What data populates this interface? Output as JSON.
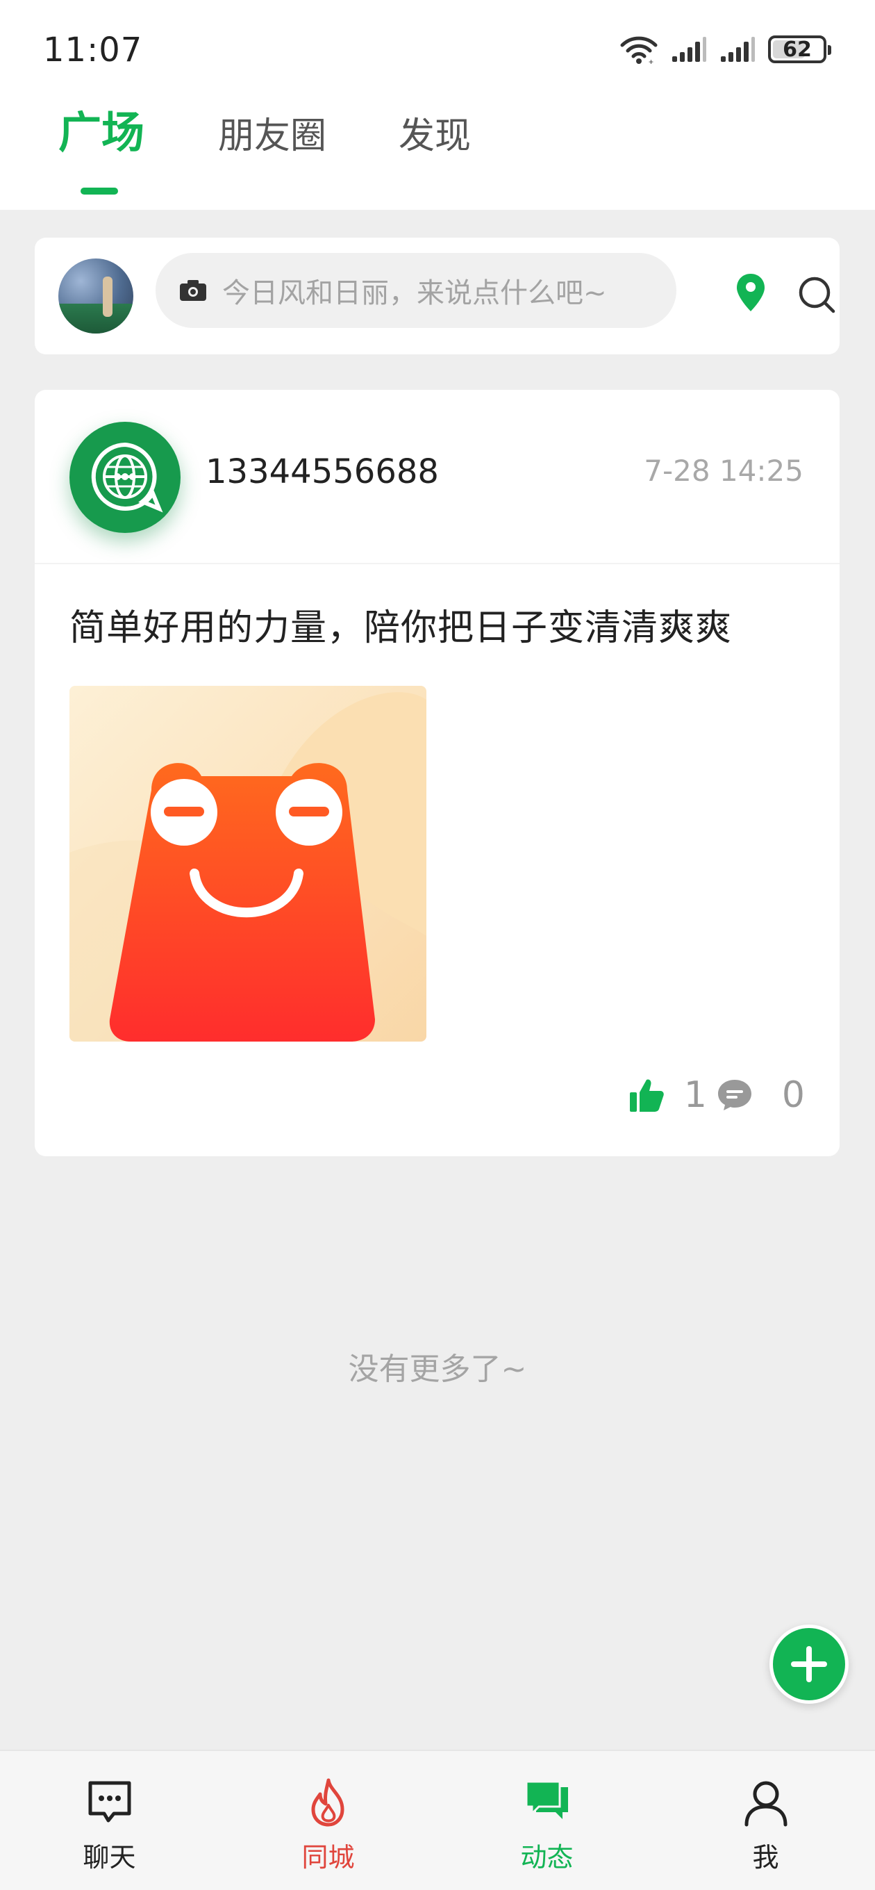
{
  "status_bar": {
    "time": "11:07",
    "battery": "62"
  },
  "top_tabs": [
    {
      "label": "广场",
      "active": true
    },
    {
      "label": "朋友圈",
      "active": false
    },
    {
      "label": "发现",
      "active": false
    }
  ],
  "composer": {
    "placeholder": "今日风和日丽，来说点什么吧~"
  },
  "post": {
    "username": "13344556688",
    "time": "7-28 14:25",
    "text": "简单好用的力量，陪你把日子变清清爽爽",
    "likes": "1",
    "comments": "0"
  },
  "feed": {
    "end_text": "没有更多了~"
  },
  "bottom_nav": [
    {
      "label": "聊天",
      "icon": "chat-bubble-icon"
    },
    {
      "label": "同城",
      "icon": "flame-icon"
    },
    {
      "label": "动态",
      "icon": "moments-icon",
      "active": true
    },
    {
      "label": "我",
      "icon": "person-icon"
    }
  ],
  "colors": {
    "accent": "#12b454",
    "city": "#e0453c",
    "background": "#eeeeee"
  }
}
